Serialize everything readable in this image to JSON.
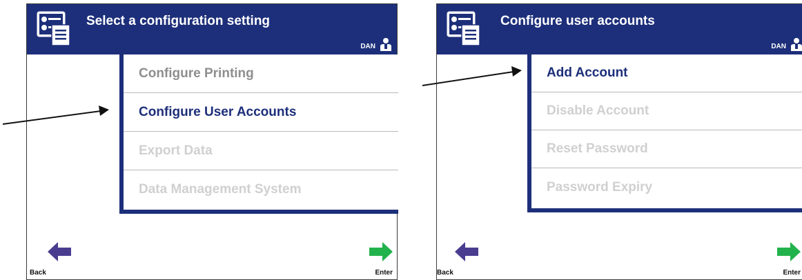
{
  "screens": [
    {
      "title": "Select a configuration setting",
      "user": "DAN",
      "menu": [
        {
          "label": "Configure Printing",
          "state": "muted"
        },
        {
          "label": "Configure User Accounts",
          "state": "active"
        },
        {
          "label": "Export Data",
          "state": "disabled"
        },
        {
          "label": "Data Management System",
          "state": "disabled"
        }
      ],
      "back_label": "Back",
      "enter_label": "Enter"
    },
    {
      "title": "Configure user accounts",
      "user": "DAN",
      "menu": [
        {
          "label": "Add Account",
          "state": "active"
        },
        {
          "label": "Disable Account",
          "state": "disabled"
        },
        {
          "label": "Reset Password",
          "state": "disabled"
        },
        {
          "label": "Password Expiry",
          "state": "disabled"
        }
      ],
      "back_label": "Back",
      "enter_label": "Enter"
    }
  ],
  "colors": {
    "header": "#1d2f7a",
    "active_text": "#1d2f7a",
    "muted_text": "#8e8e8e",
    "disabled_text": "#d0d0d0",
    "back_arrow": "#4a3d8f",
    "enter_arrow": "#22b24c"
  },
  "icons": [
    "config-app-icon",
    "user-icon",
    "back-arrow-icon",
    "enter-arrow-icon",
    "callout-arrow"
  ]
}
